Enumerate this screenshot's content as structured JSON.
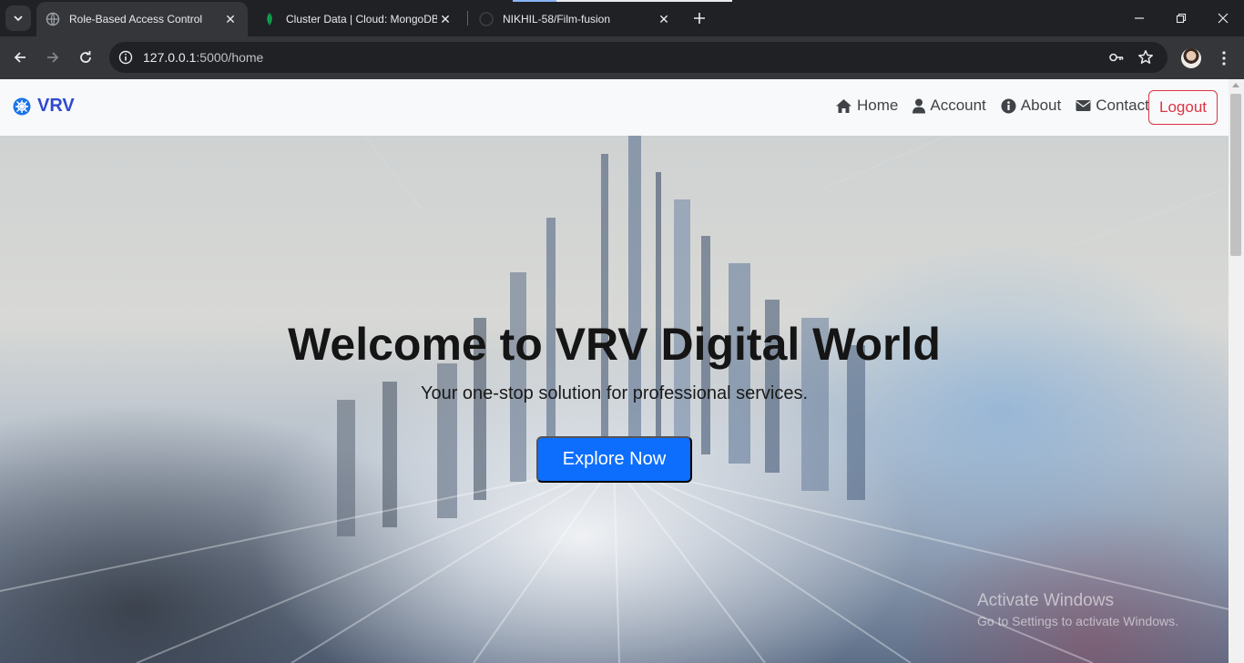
{
  "browser": {
    "tabs": [
      {
        "title": "Role-Based Access Control",
        "favicon": "globe-icon",
        "active": true
      },
      {
        "title": "Cluster Data | Cloud: MongoDB",
        "favicon": "mongodb-leaf-icon",
        "active": false
      },
      {
        "title": "NIKHIL-58/Film-fusion",
        "favicon": "github-icon",
        "active": false
      }
    ],
    "address": {
      "host": "127.0.0.1",
      "path": ":5000/home"
    }
  },
  "navbar": {
    "brand": "VRV",
    "links": [
      {
        "label": "Home",
        "icon": "home-icon"
      },
      {
        "label": "Account",
        "icon": "user-icon"
      },
      {
        "label": "About",
        "icon": "info-icon"
      },
      {
        "label": "Contact",
        "icon": "envelope-icon"
      }
    ],
    "logout": "Logout"
  },
  "hero": {
    "title": "Welcome to VRV Digital World",
    "subtitle": "Your one-stop solution for professional services.",
    "cta": "Explore Now"
  },
  "watermark": {
    "line1": "Activate Windows",
    "line2": "Go to Settings to activate Windows."
  },
  "colors": {
    "brand": "#2f49d1",
    "primary": "#0d6efd",
    "danger": "#dc3545",
    "navbar_bg": "#f8f9fa"
  }
}
